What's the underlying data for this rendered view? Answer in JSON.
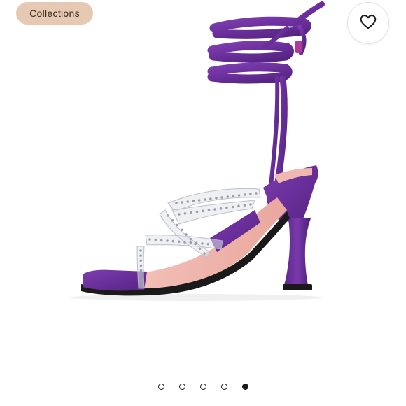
{
  "header": {
    "collections_label": "Collections",
    "favorite_icon": "heart-icon"
  },
  "product": {
    "image": "purple-satin-lace-up-sandal-with-clear-studded-straps",
    "colors": {
      "satin": "#6a2f9a",
      "insole": "#f0b8b0",
      "sole": "#1a1a1a"
    }
  },
  "carousel": {
    "total": 5,
    "active_index": 4
  },
  "theme": {
    "chip_bg": "#e6c9b3",
    "dot_color": "#1a1a1a"
  }
}
